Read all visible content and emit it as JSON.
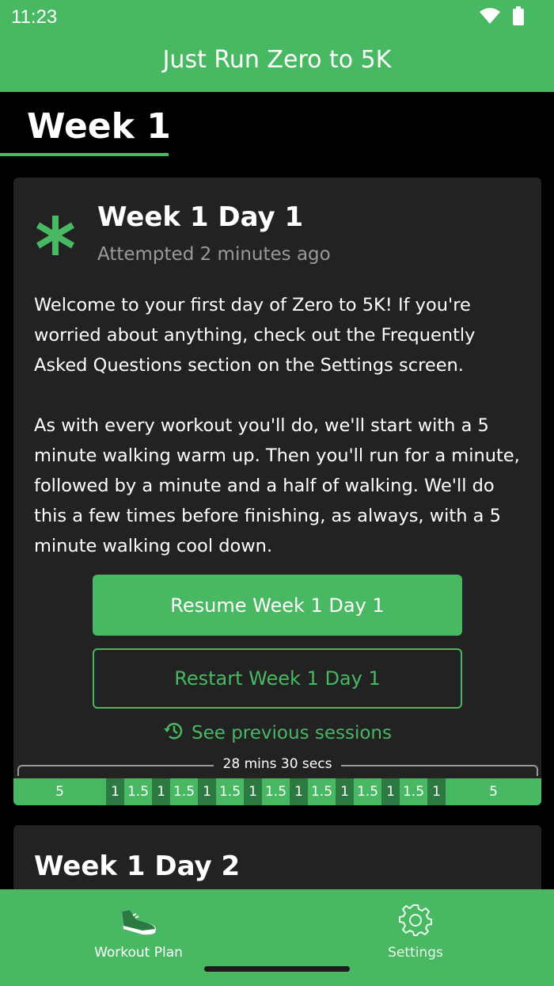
{
  "status_bar": {
    "time": "11:23",
    "icons": [
      "wifi-icon",
      "battery-icon"
    ]
  },
  "app_bar": {
    "title": "Just Run Zero to 5K"
  },
  "tab": {
    "label": "Week 1"
  },
  "workout_card": {
    "title": "Week 1 Day 1",
    "subtitle": "Attempted 2 minutes ago",
    "description_p1": "Welcome to your first day of Zero to 5K! If you're worried about anything, check out the Frequently Asked Questions section on the Settings screen.",
    "description_p2": "As with every workout you'll do, we'll start with a 5 minute walking warm up. Then you'll run for a minute, followed by a minute and a half of walking. We'll do this a few times before finishing, as always, with a 5 minute walking cool down.",
    "resume_label": "Resume Week 1 Day 1",
    "restart_label": "Restart Week 1 Day 1",
    "previous_sessions_label": "See previous sessions",
    "total_duration": "28 mins 30 secs",
    "segments": [
      {
        "type": "walk",
        "label": "5"
      },
      {
        "type": "run",
        "label": "1"
      },
      {
        "type": "walk",
        "label": "1.5"
      },
      {
        "type": "run",
        "label": "1"
      },
      {
        "type": "walk",
        "label": "1.5"
      },
      {
        "type": "run",
        "label": "1"
      },
      {
        "type": "walk",
        "label": "1.5"
      },
      {
        "type": "run",
        "label": "1"
      },
      {
        "type": "walk",
        "label": "1.5"
      },
      {
        "type": "run",
        "label": "1"
      },
      {
        "type": "walk",
        "label": "1.5"
      },
      {
        "type": "run",
        "label": "1"
      },
      {
        "type": "walk",
        "label": "1.5"
      },
      {
        "type": "run",
        "label": "1"
      },
      {
        "type": "walk",
        "label": "1.5"
      },
      {
        "type": "run",
        "label": "1"
      },
      {
        "type": "walk",
        "label": "5"
      }
    ]
  },
  "next_card": {
    "title": "Week 1 Day 2"
  },
  "bottom_nav": {
    "items": [
      {
        "label": "Workout Plan",
        "icon": "shoe-icon"
      },
      {
        "label": "Settings",
        "icon": "gear-icon"
      }
    ]
  },
  "colors": {
    "accent": "#48b862",
    "run_segment": "#2c7a42",
    "card_bg": "#222222",
    "background": "#000000"
  }
}
